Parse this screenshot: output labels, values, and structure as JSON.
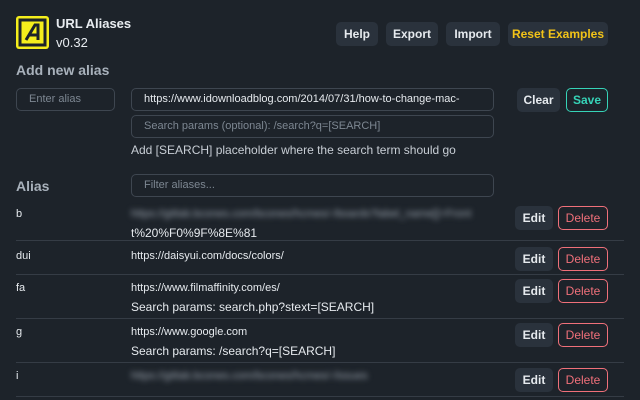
{
  "header": {
    "title": "URL Aliases",
    "version": "v0.32",
    "buttons": {
      "help": "Help",
      "export": "Export",
      "import": "Import",
      "reset": "Reset Examples"
    }
  },
  "add_alias": {
    "heading": "Add new alias",
    "alias_placeholder": "Enter alias",
    "url_value": "https://www.idownloadblog.com/2014/07/31/how-to-change-mac-",
    "params_placeholder": "Search params (optional): /search?q=[SEARCH]",
    "hint": "Add [SEARCH] placeholder where the search term should go",
    "clear_label": "Clear",
    "save_label": "Save"
  },
  "list": {
    "heading": "Alias",
    "filter_placeholder": "Filter aliases...",
    "edit_label": "Edit",
    "delete_label": "Delete",
    "params_prefix": "Search params:",
    "rows": [
      {
        "alias": "b",
        "url": "https://gitlab.bcones.com/bcones/hcmes/-/boards?label_name[]=Front",
        "url_cont": "t%20%F0%9F%8E%81",
        "params": ""
      },
      {
        "alias": "dui",
        "url": "https://daisyui.com/docs/colors/",
        "params": ""
      },
      {
        "alias": "fa",
        "url": "https://www.filmaffinity.com/es/",
        "params": "search.php?stext=[SEARCH]"
      },
      {
        "alias": "g",
        "url": "https://www.google.com",
        "params": "/search?q=[SEARCH]"
      },
      {
        "alias": "i",
        "url": "https://gitlab.bcones.com/bcones/hcmes/-/issues",
        "params": ""
      }
    ]
  },
  "colors": {
    "background": "#1d232a",
    "accent_yellow": "#f2c318",
    "save_teal": "#36d3b7",
    "delete_red": "#f0707a"
  }
}
